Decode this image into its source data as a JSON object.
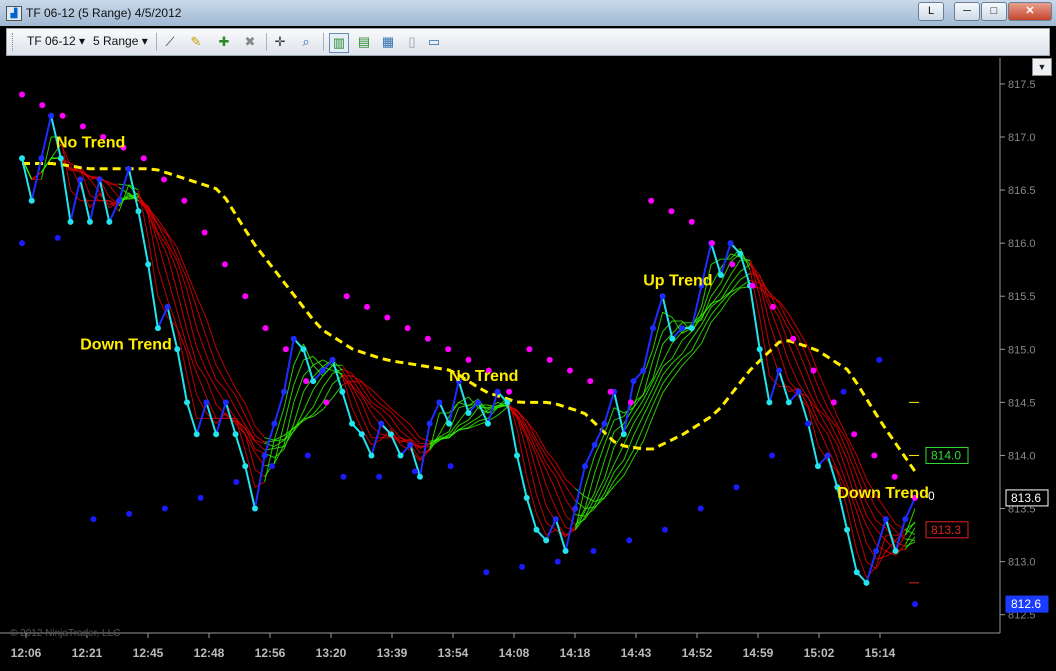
{
  "window": {
    "title": "TF 06-12 (5 Range)  4/5/2012",
    "controls": {
      "layout": "L",
      "minimize": "─",
      "maximize": "□",
      "close": "✕"
    }
  },
  "toolbar": {
    "instrument": "TF 06-12",
    "interval": "5 Range",
    "dropdown_arrow": "▾",
    "icons": [
      "line-drawing-icon",
      "pencil-icon",
      "add-marker-icon",
      "remove-marker-icon",
      "crosshair-icon",
      "zoom-icon",
      "chart-style-icon",
      "indicators-icon",
      "strategies-icon",
      "data-box-icon",
      "properties-icon"
    ]
  },
  "colors": {
    "background": "#000000",
    "price_line": "#22e3ee",
    "up_segment": "#1e2dff",
    "sar_upper": "#ff00ff",
    "sar_lower": "#1a1aff",
    "trend_ma": "#ffee00",
    "label": "#ffee00",
    "ribbon_down": "#e60000",
    "ribbon_up": "#33ee00"
  },
  "chart_data": {
    "type": "line",
    "y_axis": {
      "ticks": [
        817.5,
        817.0,
        816.5,
        816.0,
        815.5,
        815.0,
        814.5,
        814.0,
        813.5,
        813.0,
        812.5
      ],
      "range": [
        812.45,
        817.65
      ]
    },
    "x_axis": {
      "ticks": [
        "12:06",
        "12:21",
        "12:45",
        "12:48",
        "12:56",
        "13:20",
        "13:39",
        "13:54",
        "14:08",
        "14:18",
        "14:43",
        "14:52",
        "14:59",
        "15:02",
        "15:14"
      ]
    },
    "price": [
      816.8,
      816.4,
      816.8,
      817.2,
      816.8,
      816.2,
      816.6,
      816.2,
      816.6,
      816.2,
      816.4,
      816.7,
      816.3,
      815.8,
      815.2,
      815.4,
      815.0,
      814.5,
      814.2,
      814.5,
      814.2,
      814.5,
      814.2,
      813.9,
      813.5,
      814.0,
      814.3,
      814.6,
      815.1,
      815.0,
      814.7,
      814.8,
      814.9,
      814.6,
      814.3,
      814.2,
      814.0,
      814.3,
      814.2,
      814.0,
      814.1,
      813.8,
      814.3,
      814.5,
      814.3,
      814.7,
      814.4,
      814.5,
      814.3,
      814.6,
      814.5,
      814.0,
      813.6,
      813.3,
      813.2,
      813.4,
      813.1,
      813.5,
      813.9,
      814.1,
      814.3,
      814.6,
      814.2,
      814.7,
      814.8,
      815.2,
      815.5,
      815.1,
      815.2,
      815.2,
      815.6,
      816.0,
      815.7,
      816.0,
      815.9,
      815.6,
      815.0,
      814.5,
      814.8,
      814.5,
      814.6,
      814.3,
      813.9,
      814.0,
      813.7,
      813.3,
      812.9,
      812.8,
      813.1,
      813.4,
      813.1,
      813.4,
      813.6
    ],
    "trend_ma": [
      816.75,
      816.75,
      816.7,
      816.7,
      816.7,
      816.6,
      816.5,
      816.0,
      815.6,
      815.2,
      815.0,
      814.9,
      814.85,
      814.8,
      814.6,
      814.5,
      814.5,
      814.4,
      814.1,
      814.05,
      814.2,
      814.4,
      814.8,
      815.1,
      815.0,
      814.8,
      814.3,
      813.85
    ],
    "sar_upper": [
      817.4,
      817.3,
      817.2,
      817.1,
      817.0,
      816.9,
      816.8,
      816.6,
      816.4,
      816.1,
      815.8,
      815.5,
      815.2,
      815.0,
      814.7,
      814.5,
      815.5,
      815.4,
      815.3,
      815.2,
      815.1,
      815.0,
      814.9,
      814.8,
      814.6,
      815.0,
      814.9,
      814.8,
      814.7,
      814.6,
      814.5,
      816.4,
      816.3,
      816.2,
      816.0,
      815.8,
      815.6,
      815.4,
      815.1,
      814.8,
      814.5,
      814.2,
      814.0,
      813.8,
      813.6
    ],
    "sar_lower": [
      816.0,
      816.05,
      813.4,
      813.45,
      813.5,
      813.6,
      813.75,
      813.9,
      814.0,
      813.8,
      813.8,
      813.85,
      813.9,
      812.9,
      812.95,
      813.0,
      813.1,
      813.2,
      813.3,
      813.5,
      813.7,
      814.0,
      814.3,
      814.6,
      814.9,
      812.6
    ],
    "right_axis_labels": [
      {
        "text": "814.0",
        "value": 814.0,
        "color": "#33dd33"
      },
      {
        "text": "813.3",
        "value": 813.3,
        "color": "#dd2222"
      },
      {
        "text": "813.6",
        "value": 813.6,
        "color": "#ffffff"
      },
      {
        "text": "812.6",
        "value": 812.6,
        "color": "#1a3cff"
      },
      {
        "text": "0",
        "value": 813.62,
        "color": "#ffffff"
      }
    ],
    "annotations": [
      {
        "text": "No Trend",
        "x": 3.5,
        "y": 816.9
      },
      {
        "text": "Down Trend",
        "x": 6,
        "y": 815.0
      },
      {
        "text": "No Trend",
        "x": 44,
        "y": 814.7
      },
      {
        "text": "Up Trend",
        "x": 64,
        "y": 815.6
      },
      {
        "text": "Down Trend",
        "x": 84,
        "y": 813.6
      }
    ],
    "copyright": "© 2012 NinjaTrader, LLC"
  }
}
